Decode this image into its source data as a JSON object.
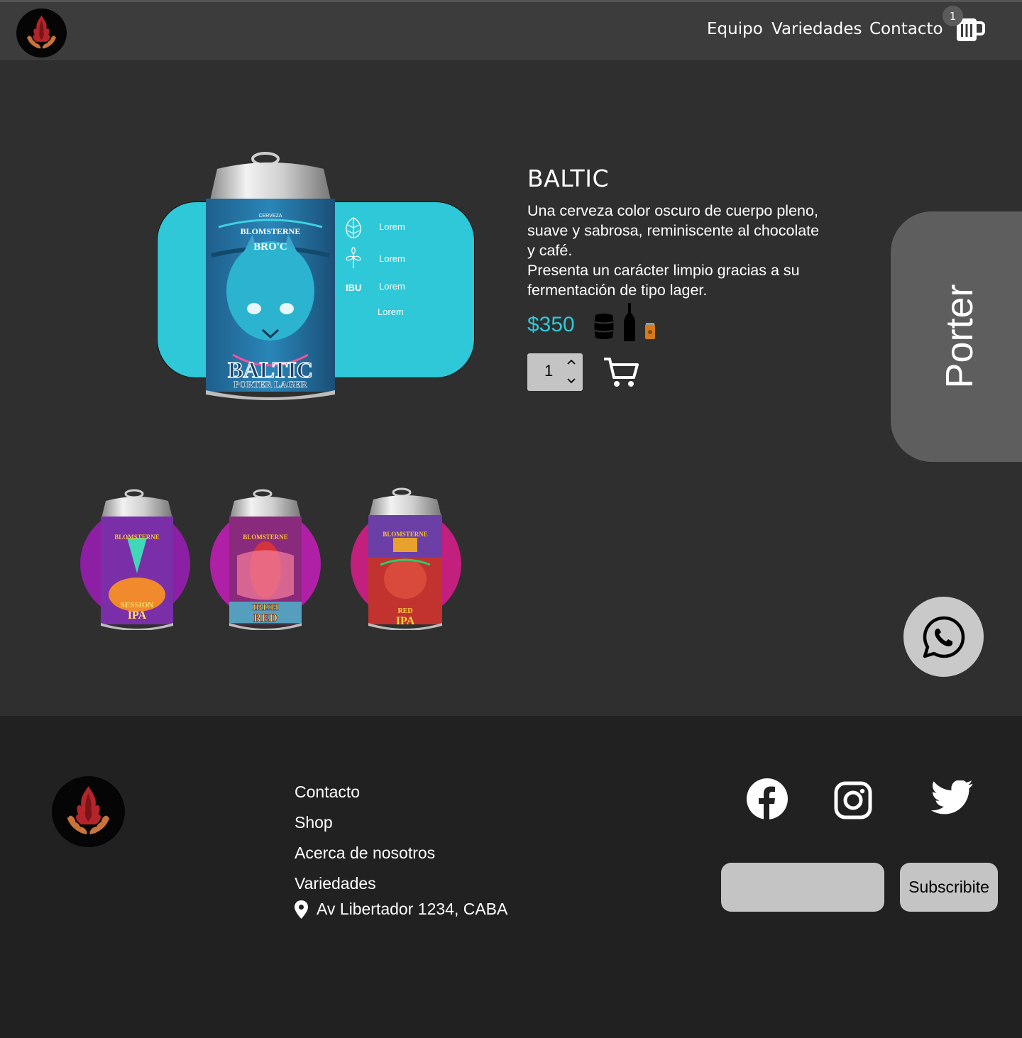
{
  "header": {
    "nav": [
      "Equipo",
      "Variedades",
      "Contacto"
    ],
    "cart_count": "1"
  },
  "product": {
    "name": "BALTIC",
    "description_lines": [
      "Una cerveza color oscuro de cuerpo pleno, suave y sabrosa, reminiscente al chocolate y café.",
      "Presenta un carácter limpio gracias a su fermentación de tipo lager."
    ],
    "price": "$350",
    "quantity": "1",
    "stats": [
      "Lorem",
      "Lorem",
      "Lorem",
      "Lorem"
    ],
    "ibu_label": "IBU",
    "can_label": {
      "brand_small": "CERVEZA",
      "brand": "BLOMSTERNE",
      "sub": "BRO'C",
      "name": "BALTIC",
      "style": "PORTER LAGER"
    },
    "accent_color": "#2ec8d8"
  },
  "category_tab": "Porter",
  "related": [
    {
      "brand": "BLOMSTERNE",
      "name_top": "SESSION",
      "name_bottom": "IPA",
      "can_color": "#7a2ea8",
      "circle_color": "#8c1fa3"
    },
    {
      "brand": "BLOMSTERNE",
      "name_top": "IRISH",
      "name_bottom": "RED",
      "can_color": "#8a2a7c",
      "circle_color": "#b020a6"
    },
    {
      "brand": "BLOMSTERNE",
      "name_top": "RED",
      "name_bottom": "IPA",
      "can_color": "#c2332f",
      "circle_color": "#c21f7e"
    }
  ],
  "footer": {
    "links": [
      "Contacto",
      "Shop",
      "Acerca de nosotros",
      "Variedades"
    ],
    "address": "Av Libertador 1234, CABA",
    "subscribe_label": "Subscribite",
    "subscribe_placeholder": "",
    "social": [
      "facebook-icon",
      "instagram-icon",
      "twitter-icon"
    ]
  }
}
